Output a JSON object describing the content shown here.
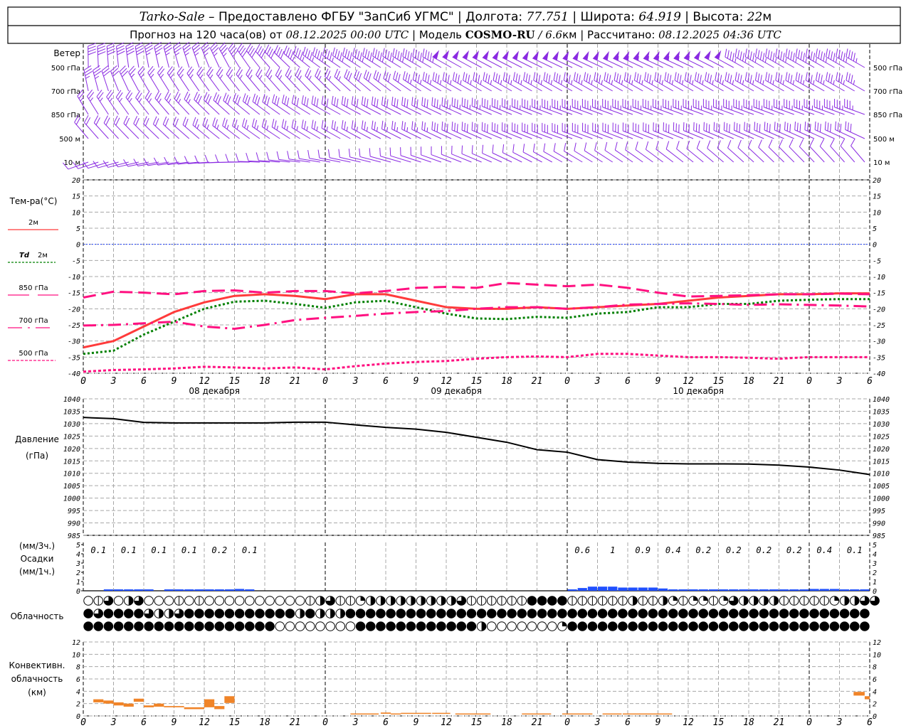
{
  "header": {
    "station": "Tarko-Sale",
    "provider": " – Предоставлено ФГБУ \"ЗапСиб УГМС\" | Долгота: ",
    "lon": "77.751",
    "lat_label": " | Широта: ",
    "lat": "64.919",
    "alt_label": " | Высота: ",
    "alt": "22",
    "alt_unit": "м",
    "forecast_prefix": "Прогноз на 120 часа(ов) от ",
    "forecast_start": "08.12.2025 00:00 UTC",
    "model_label": "  | Модель ",
    "model": "COSMO-RU",
    "resolution": " / 6.6",
    "resolution_unit": "км",
    "computed_label": " | Рассчитано: ",
    "computed": "08.12.2025 04:36 UTC"
  },
  "colors": {
    "wind": "#8a2be2",
    "t2m": "#ff3b3b",
    "td2m": "#008000",
    "levels": "#ff1080",
    "zero_line": "#2040ff",
    "pressure": "#000000",
    "precip": "#2050ff",
    "convective": "#f08428",
    "grid": "#a8a8a8"
  },
  "wind": {
    "title": "Ветер",
    "levels": [
      {
        "label": "500 гПа",
        "keys": [
          [
            0,
            0,
            40
          ],
          [
            12,
            340,
            35
          ],
          [
            18,
            320,
            40
          ],
          [
            24,
            305,
            45
          ],
          [
            48,
            295,
            50
          ],
          [
            60,
            295,
            55
          ],
          [
            66,
            300,
            45
          ],
          [
            78,
            300,
            45
          ]
        ]
      },
      {
        "label": "700 гПа",
        "keys": [
          [
            0,
            350,
            35
          ],
          [
            6,
            330,
            25
          ],
          [
            24,
            315,
            25
          ],
          [
            36,
            300,
            35
          ],
          [
            78,
            300,
            35
          ]
        ]
      },
      {
        "label": "850 гПа",
        "keys": [
          [
            0,
            330,
            25
          ],
          [
            24,
            300,
            30
          ],
          [
            48,
            290,
            35
          ],
          [
            78,
            290,
            35
          ]
        ]
      },
      {
        "label": "500 м",
        "keys": [
          [
            0,
            320,
            20
          ],
          [
            24,
            300,
            25
          ],
          [
            48,
            290,
            30
          ],
          [
            78,
            295,
            30
          ]
        ]
      },
      {
        "label": "10 м",
        "keys": [
          [
            0,
            250,
            8
          ],
          [
            24,
            280,
            10
          ],
          [
            48,
            300,
            12
          ],
          [
            78,
            320,
            12
          ]
        ]
      }
    ]
  },
  "legend": {
    "temp_title": "Тем-ра(°C)",
    "t2m": "2м",
    "td_symbol": "Td",
    "td_level": "2м",
    "l850": "850 гПа",
    "l700": "700 гПа",
    "l500": "500 гПа",
    "pressure_title": "Давление",
    "pressure_unit": "(гПа)",
    "precip_unit3": "(мм/3ч.)",
    "precip_title": "Осадки",
    "precip_unit1": "(мм/1ч.)",
    "cloud_title": "Облачность",
    "conv_title1": "Конвективн.",
    "conv_title2": "облачность",
    "conv_unit": "(км)"
  },
  "chart_data": [
    {
      "type": "line",
      "title": "Тем-ра(°C)",
      "x_hours": [
        0,
        3,
        6,
        9,
        12,
        15,
        18,
        21,
        24,
        27,
        30,
        33,
        36,
        39,
        42,
        45,
        48,
        51,
        54,
        57,
        60,
        63,
        66,
        69,
        72,
        75,
        78
      ],
      "ylim": [
        -40,
        20
      ],
      "yticks": [
        20,
        15,
        10,
        5,
        0,
        -5,
        -10,
        -15,
        -20,
        -25,
        -30,
        -35,
        -40
      ],
      "series": [
        {
          "name": "2м",
          "values": [
            -32,
            -30,
            -25.5,
            -21,
            -18,
            -16,
            -15.5,
            -16,
            -17,
            -15.5,
            -15.5,
            -17.5,
            -19.5,
            -20,
            -20,
            -19.5,
            -20,
            -19.5,
            -19,
            -18.5,
            -17.5,
            -16.5,
            -16,
            -15.5,
            -15.5,
            -15.2,
            -15.2
          ]
        },
        {
          "name": "Td 2м",
          "values": [
            -34,
            -33,
            -28,
            -24,
            -20,
            -17.8,
            -17.5,
            -18.5,
            -19.7,
            -18,
            -17.5,
            -19.5,
            -21.5,
            -23,
            -23.2,
            -22.5,
            -22.8,
            -21.5,
            -21,
            -19.5,
            -19.5,
            -18.5,
            -18.5,
            -17.5,
            -17.2,
            -17,
            -17
          ]
        },
        {
          "name": "850 гПа",
          "values": [
            -16.5,
            -14.7,
            -15,
            -15.5,
            -14.5,
            -14.3,
            -15,
            -14.5,
            -14.5,
            -15.2,
            -14.5,
            -13.5,
            -13.2,
            -13.5,
            -12,
            -12.5,
            -13,
            -12.5,
            -13.5,
            -15,
            -16.2,
            -16,
            -15.8,
            -15.5,
            -15.5,
            -15.3,
            -15.5
          ]
        },
        {
          "name": "700 гПа",
          "values": [
            -25.2,
            -25,
            -24.5,
            -24,
            -25.5,
            -26.2,
            -25,
            -23.5,
            -22.8,
            -22.2,
            -21.5,
            -21,
            -20.7,
            -20,
            -19.5,
            -19.5,
            -20,
            -19.5,
            -18.7,
            -18.5,
            -18.3,
            -18.5,
            -18.8,
            -18.6,
            -18.8,
            -19,
            -19.3
          ]
        },
        {
          "name": "500 гПа",
          "values": [
            -39.5,
            -39,
            -38.8,
            -38.5,
            -38,
            -38.2,
            -38.5,
            -38.2,
            -38.8,
            -37.8,
            -37,
            -36.5,
            -36.2,
            -35.5,
            -35,
            -34.8,
            -35,
            -34,
            -34,
            -34.5,
            -35,
            -35,
            -35.2,
            -35.5,
            -35,
            -35,
            -35
          ]
        }
      ]
    },
    {
      "type": "line",
      "title": "Давление (гПа)",
      "x_hours": [
        0,
        3,
        6,
        9,
        12,
        15,
        18,
        21,
        24,
        27,
        30,
        33,
        36,
        39,
        42,
        45,
        48,
        51,
        54,
        57,
        60,
        63,
        66,
        69,
        72,
        75,
        78
      ],
      "ylim": [
        985,
        1040
      ],
      "yticks": [
        1040,
        1035,
        1030,
        1025,
        1020,
        1015,
        1010,
        1005,
        1000,
        995,
        990,
        985
      ],
      "series": [
        {
          "name": "Давление",
          "values": [
            1032.5,
            1032,
            1030.5,
            1030.3,
            1030.3,
            1030.3,
            1030.3,
            1030.6,
            1030.6,
            1029.5,
            1028.5,
            1027.8,
            1026.5,
            1024.5,
            1022.5,
            1019.5,
            1018.5,
            1015.5,
            1014.5,
            1014,
            1013.8,
            1013.8,
            1013.7,
            1013.3,
            1012.5,
            1011.3,
            1009.5
          ]
        }
      ]
    },
    {
      "type": "bar",
      "title": "Осадки (мм/1ч.)",
      "ylim": [
        0,
        5
      ],
      "yticks": [
        0,
        1,
        2,
        3,
        4,
        5
      ],
      "hourly_values": [
        0,
        0,
        0.05,
        0.05,
        0.1,
        0.1,
        0.1,
        0,
        0.05,
        0.1,
        0.05,
        0.1,
        0.1,
        0.05,
        0.1,
        0.2,
        0.05,
        0,
        0,
        0,
        0,
        0,
        0,
        0,
        0,
        0,
        0,
        0,
        0,
        0,
        0,
        0,
        0,
        0,
        0,
        0,
        0,
        0,
        0,
        0,
        0,
        0,
        0,
        0,
        0,
        0,
        0,
        0,
        0.05,
        0.3,
        0.45,
        0.45,
        0.45,
        0.35,
        0.35,
        0.35,
        0.35,
        0.25,
        0.15,
        0.1,
        0.1,
        0.1,
        0.12,
        0.1,
        0.12,
        0.12,
        0.1,
        0.12,
        0.12,
        0.12,
        0.12,
        0.12,
        0.2,
        0.2,
        0.2,
        0.12,
        0.12,
        0.05
      ],
      "totals_3h": [
        {
          "hour": 1.5,
          "label": "0.1"
        },
        {
          "hour": 4.5,
          "label": "0.1"
        },
        {
          "hour": 7.5,
          "label": "0.1"
        },
        {
          "hour": 10.5,
          "label": "0.1"
        },
        {
          "hour": 13.5,
          "label": "0.2"
        },
        {
          "hour": 16.5,
          "label": "0.1"
        },
        {
          "hour": 49.5,
          "label": "0.6"
        },
        {
          "hour": 52.5,
          "label": "1"
        },
        {
          "hour": 55.5,
          "label": "0.9"
        },
        {
          "hour": 58.5,
          "label": "0.4"
        },
        {
          "hour": 61.5,
          "label": "0.2"
        },
        {
          "hour": 64.5,
          "label": "0.2"
        },
        {
          "hour": 67.5,
          "label": "0.2"
        },
        {
          "hour": 70.5,
          "label": "0.2"
        },
        {
          "hour": 73.5,
          "label": "0.4"
        },
        {
          "hour": 76.5,
          "label": "0.1"
        }
      ]
    },
    {
      "type": "table",
      "title": "Облачность",
      "encoding": "o=0, v=1/8, q=1/4, h=1/2, t=3/4, f=full; rows: upper, middle, lower; one symbol per hour",
      "rows": [
        "ovtohtooovovoooooooooovhtvvqhhhhhhhhhtvvvvvvffffvvvvvvhvvhqvqqvqthhhhvvvvvqhhtt",
        "ftffffthhtfffffffffffhfhhhffffffffffffffffffffffffffffffffffffffffffffffffffff",
        "fffffffffffffffffffooooooooffffffffffffhoooooooqffffffffffffffffffffffffffffff"
      ]
    },
    {
      "type": "bar",
      "title": "Конвективн. облачность (км)",
      "ylim": [
        0,
        12
      ],
      "yticks": [
        0,
        2,
        4,
        6,
        8,
        10,
        12
      ],
      "layers": [
        [
          1,
          2,
          2.2,
          2.7
        ],
        [
          2,
          3,
          2.0,
          2.5
        ],
        [
          3,
          4,
          1.7,
          2.2
        ],
        [
          4,
          5,
          1.5,
          2.0
        ],
        [
          5,
          6,
          2.3,
          2.8
        ],
        [
          6,
          7,
          1.4,
          1.7
        ],
        [
          7,
          8,
          1.5,
          2.0
        ],
        [
          8,
          10,
          1.4,
          1.6
        ],
        [
          10,
          12,
          1.1,
          1.4
        ],
        [
          12,
          13,
          1.4,
          2.7
        ],
        [
          13,
          14,
          1.1,
          1.6
        ],
        [
          14,
          15,
          2.1,
          3.2
        ],
        [
          26.5,
          29.3,
          0.3,
          0.4
        ],
        [
          29.5,
          30.5,
          0.35,
          0.55
        ],
        [
          30.5,
          31.5,
          0.3,
          0.4
        ],
        [
          31.5,
          34.5,
          0.4,
          0.5
        ],
        [
          34.6,
          36.4,
          0.4,
          0.5
        ],
        [
          36.9,
          40.4,
          0.3,
          0.4
        ],
        [
          43.5,
          46.4,
          0.3,
          0.4
        ],
        [
          47.5,
          50.5,
          0.3,
          0.4
        ],
        [
          51.5,
          53.4,
          0.3,
          0.4
        ],
        [
          53.5,
          58.4,
          0.3,
          0.4
        ],
        [
          76.4,
          77.5,
          3.3,
          3.9
        ],
        [
          77.5,
          78,
          2.7,
          3.2
        ]
      ]
    }
  ],
  "time_axis": {
    "hour_labels": [
      "0",
      "3",
      "6",
      "9",
      "12",
      "15",
      "18",
      "21",
      "0",
      "3",
      "6",
      "9",
      "12",
      "15",
      "18",
      "21",
      "0",
      "3",
      "6",
      "9",
      "12",
      "15",
      "18",
      "21",
      "0",
      "3",
      "6"
    ],
    "days": [
      {
        "hour": 13,
        "label": "08 декабря"
      },
      {
        "hour": 37,
        "label": "09 декабря"
      },
      {
        "hour": 61,
        "label": "10 декабря"
      }
    ]
  }
}
